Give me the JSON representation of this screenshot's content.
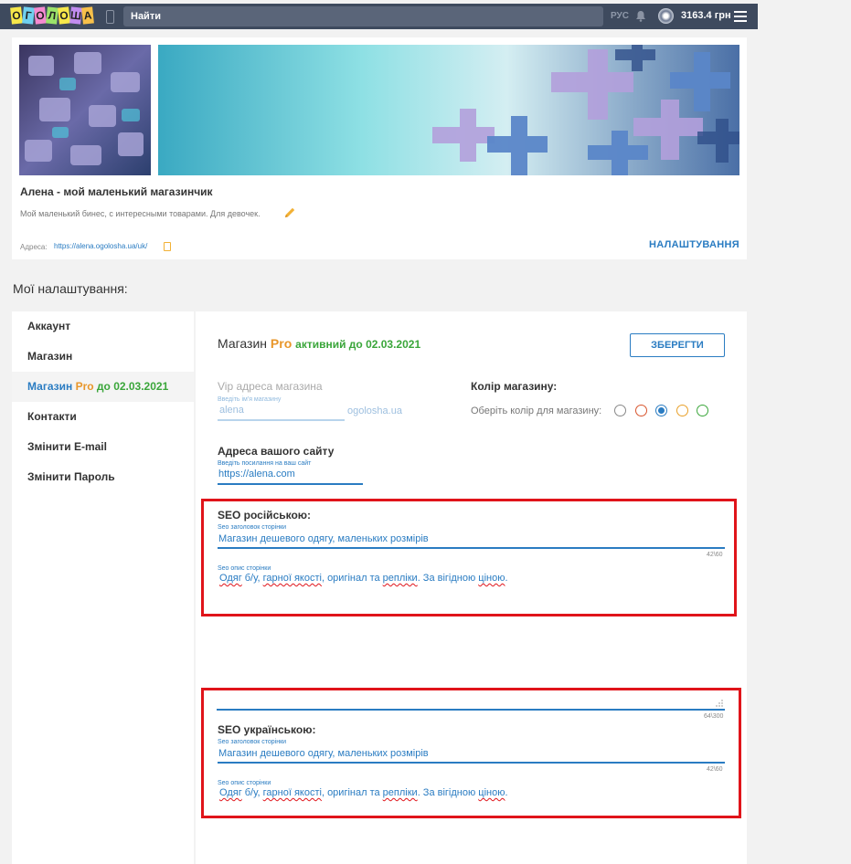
{
  "topbar": {
    "logo_letters": [
      "О",
      "Г",
      "О",
      "Л",
      "О",
      "Ш",
      "А"
    ],
    "logo_colors": [
      "#f7e84a",
      "#6fd0ef",
      "#f58ad0",
      "#9be36a",
      "#f7e84a",
      "#c18cf0",
      "#f7c04a"
    ],
    "search_placeholder": "Найти",
    "lang": "РУС",
    "balance": "3163.4 грн",
    "icons": [
      "phone-icon",
      "bell-icon",
      "avatar-icon",
      "menu-icon"
    ]
  },
  "profile": {
    "shop_name": "Алена - мой маленький магазинчик",
    "description": "Мой маленький бинес, с интересными товарами. Для девочек.",
    "address_label": "Адреса:",
    "address_url": "https://alena.ogolosha.ua/uk/",
    "settings_link": "НАЛАШТУВАННЯ"
  },
  "section_title": "Мої налаштування:",
  "sidebar": {
    "items": [
      {
        "label": "Аккаунт"
      },
      {
        "label": "Магазин"
      },
      {
        "label_a": "Магазин ",
        "label_pro": "Pro",
        "label_b": " до 02.03.2021"
      },
      {
        "label": "Контакти"
      },
      {
        "label": "Змінити E-mail"
      },
      {
        "label": "Змінити Пароль"
      }
    ]
  },
  "main": {
    "title_a": "Магазин",
    "title_pro": "Pro",
    "title_status": "активний до 02.03.2021",
    "save_button": "ЗБЕРЕГТИ",
    "vip_label": "Vip адреса магазина",
    "vip_hint": "Введіть ім'я магазину",
    "vip_value": "alena",
    "vip_domain": "ogolosha.ua",
    "color_title": "Колір магазину:",
    "color_label": "Оберіть колір для магазину:",
    "colors": [
      {
        "hex": "#888888",
        "selected": false
      },
      {
        "hex": "#d8552e",
        "selected": false
      },
      {
        "hex": "#2a7cc2",
        "selected": true
      },
      {
        "hex": "#e8a02a",
        "selected": false
      },
      {
        "hex": "#3aa63a",
        "selected": false
      }
    ],
    "site_title": "Адреса вашого сайту",
    "site_hint": "Введіть посилання на ваш сайт",
    "site_value": "https://alena.com"
  },
  "seo_ru": {
    "heading": "SEO російською:",
    "title_hint": "Seo заголовок сторінки",
    "title_value": "Магазин дешевого одягу, маленьких розмірів",
    "title_counter": "42\\60",
    "desc_hint": "Seo опис сторінки",
    "desc_value_parts": [
      "Одяг",
      " б/у, ",
      "гарної якості",
      ", оригінал та ",
      "репліки",
      ". За вігідною ",
      "ціною",
      "."
    ]
  },
  "seo_ua": {
    "top_counter": "64\\300",
    "heading": "SEO українською:",
    "title_hint": "Seo заголовок сторінки",
    "title_value": "Магазин дешевого одягу, маленьких розмірів",
    "title_counter": "42\\60",
    "desc_hint": "Seo опис сторінки",
    "desc_value_parts": [
      "Одяг",
      " б/у, ",
      "гарної якості",
      ", оригінал та ",
      "репліки",
      ". За вігідною ",
      "ціною",
      "."
    ]
  }
}
